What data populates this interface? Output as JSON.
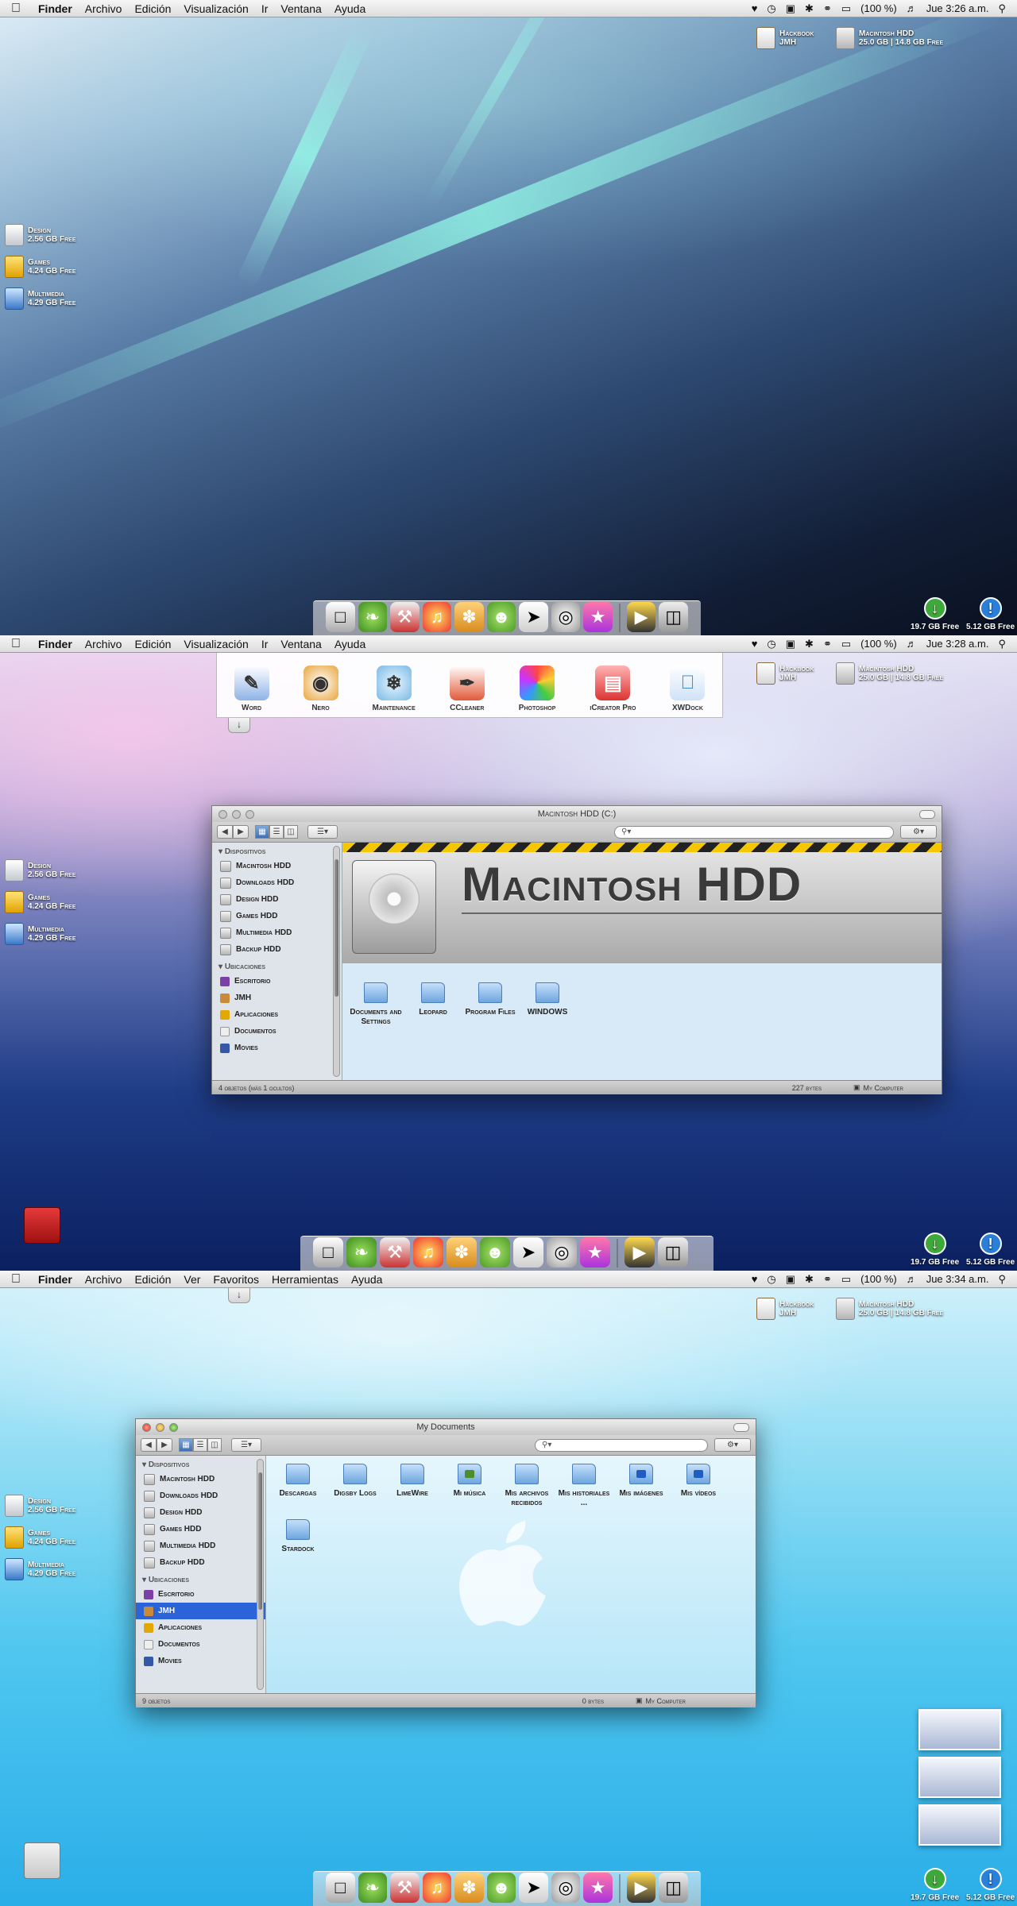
{
  "screens": [
    {
      "menubar": {
        "apple": "",
        "items": [
          "Finder",
          "Archivo",
          "Edición",
          "Visualización",
          "Ir",
          "Ventana",
          "Ayuda"
        ],
        "status_battery": "(100 %)",
        "clock": "Jue 3:26 a.m."
      },
      "top_volumes": [
        {
          "name": "Hackbook",
          "sub": "JMH"
        },
        {
          "name": "Macintosh HDD",
          "sub": "25.0 GB | 14.8 GB Free"
        }
      ],
      "left_volumes": [
        {
          "name": "Design",
          "free": "2.56 GB Free"
        },
        {
          "name": "Games",
          "free": "4.24 GB Free"
        },
        {
          "name": "Multimedia",
          "free": "4.29 GB Free"
        }
      ],
      "corner": [
        {
          "label": "19.7 GB Free"
        },
        {
          "label": "5.12 GB Free"
        }
      ]
    },
    {
      "menubar": {
        "apple": "",
        "items": [
          "Finder",
          "Archivo",
          "Edición",
          "Visualización",
          "Ir",
          "Ventana",
          "Ayuda"
        ],
        "status_battery": "(100 %)",
        "clock": "Jue 3:28 a.m."
      },
      "stack": [
        {
          "label": "Word"
        },
        {
          "label": "Nero"
        },
        {
          "label": "Maintenance"
        },
        {
          "label": "CCleaner"
        },
        {
          "label": "Photoshop"
        },
        {
          "label": "iCreator Pro"
        },
        {
          "label": "XWDock"
        }
      ],
      "top_volumes": [
        {
          "name": "Hackbook",
          "sub": "JMH"
        },
        {
          "name": "Macintosh HDD",
          "sub": "25.0 GB | 14.8 GB Free"
        }
      ],
      "left_volumes": [
        {
          "name": "Design",
          "free": "2.56 GB Free"
        },
        {
          "name": "Games",
          "free": "4.24 GB Free"
        },
        {
          "name": "Multimedia",
          "free": "4.29 GB Free"
        }
      ],
      "window": {
        "title": "Macintosh HDD (C:)",
        "banner_title": "Macintosh HDD",
        "sidebar_devices_header": "Dispositivos",
        "devices": [
          "Macintosh HDD",
          "Downloads HDD",
          "Design HDD",
          "Games HDD",
          "Multimedia HDD",
          "Backup HDD"
        ],
        "places_header": "Ubicaciones",
        "places": [
          "Escritorio",
          "JMH",
          "Aplicaciones",
          "Documentos",
          "Movies"
        ],
        "files": [
          "Documents and Settings",
          "Leopard",
          "Program Files",
          "WINDOWS"
        ],
        "status_left": "4 objetos (más 1 ocultos)",
        "status_size": "227 bytes",
        "status_loc": "My Computer"
      },
      "corner": [
        {
          "label": "19.7 GB Free"
        },
        {
          "label": "5.12 GB Free"
        }
      ]
    },
    {
      "menubar": {
        "apple": "",
        "items": [
          "Finder",
          "Archivo",
          "Edición",
          "Ver",
          "Favoritos",
          "Herramientas",
          "Ayuda"
        ],
        "status_battery": "(100 %)",
        "clock": "Jue 3:34 a.m."
      },
      "top_volumes": [
        {
          "name": "Hackbook",
          "sub": "JMH"
        },
        {
          "name": "Macintosh HDD",
          "sub": "25.0 GB | 14.8 GB Free"
        }
      ],
      "left_volumes": [
        {
          "name": "Design",
          "free": "2.56 GB Free"
        },
        {
          "name": "Games",
          "free": "4.24 GB Free"
        },
        {
          "name": "Multimedia",
          "free": "4.29 GB Free"
        }
      ],
      "window": {
        "title": "My Documents",
        "sidebar_devices_header": "Dispositivos",
        "devices": [
          "Macintosh HDD",
          "Downloads HDD",
          "Design HDD",
          "Games HDD",
          "Multimedia HDD",
          "Backup HDD"
        ],
        "places_header": "Ubicaciones",
        "places": [
          "Escritorio",
          "JMH",
          "Aplicaciones",
          "Documentos",
          "Movies"
        ],
        "files": [
          "Descargas",
          "Digsby Logs",
          "LimeWire",
          "Mi música",
          "Mis archivos recibidos",
          "Mis historiales ...",
          "Mis imágenes",
          "Mis vídeos",
          "Stardock"
        ],
        "status_left": "9 objetos",
        "status_size": "0 bytes",
        "status_loc": "My Computer"
      },
      "corner": [
        {
          "label": "19.7 GB Free"
        },
        {
          "label": "5.12 GB Free"
        }
      ]
    }
  ],
  "colors": {
    "selection": "#2a64d8",
    "finder_folder": "#6ea5df",
    "hazard_yellow": "#f5c700",
    "download_green": "#3ea83a",
    "info_blue": "#2a7fd8"
  },
  "icons": {
    "dock": [
      "finder-icon",
      "leaf-icon",
      "tools-icon",
      "itunes-icon",
      "yoshi-icon",
      "adium-icon",
      "paper-plane-icon",
      "dvd-icon",
      "launcher-icon",
      "clapper-icon",
      "trash-icon"
    ],
    "status": [
      "heart-icon",
      "time-machine-icon",
      "display-icon",
      "bluetooth-icon",
      "wifi-icon",
      "battery-icon",
      "volume-icon",
      "spotlight-icon"
    ]
  }
}
